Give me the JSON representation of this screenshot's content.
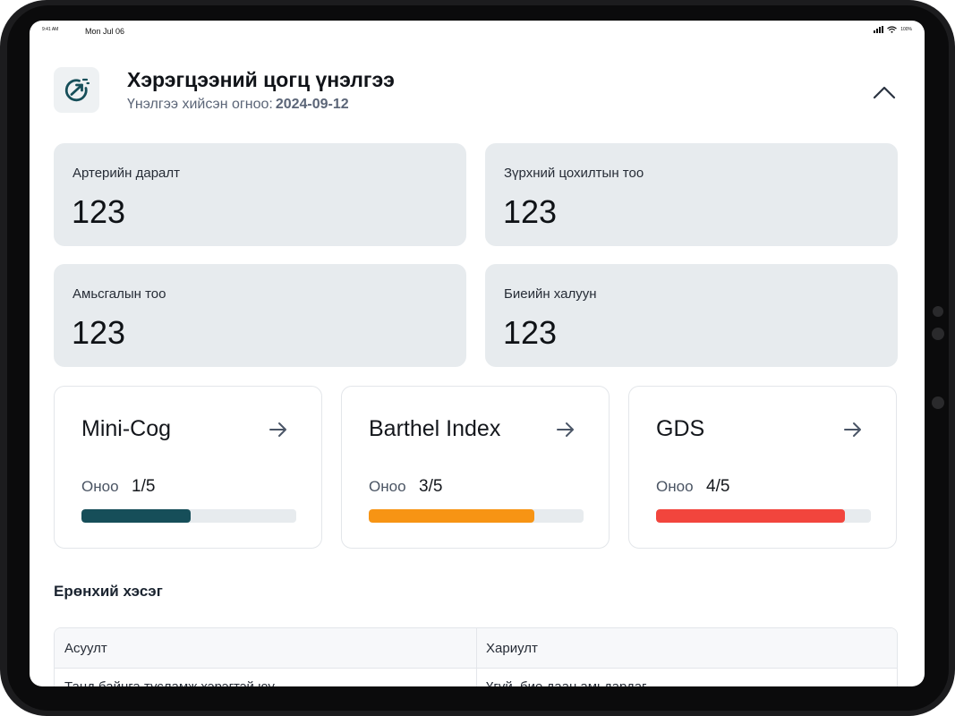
{
  "status_bar": {
    "time": "9:41 AM",
    "date": "Mon Jul 06",
    "battery": "100%"
  },
  "header": {
    "title": "Хэрэгцээний цогц үнэлгээ",
    "subtitle_label": "Үнэлгээ хийсэн огноо:",
    "subtitle_date": "2024-09-12",
    "icon": "gauge-icon",
    "collapse_icon": "chevron-up-icon"
  },
  "vitals": [
    {
      "label": "Артерийн даралт",
      "value": "123"
    },
    {
      "label": "Зүрхний цохилтын тоо",
      "value": "123"
    },
    {
      "label": "Амьсгалын тоо",
      "value": "123"
    },
    {
      "label": "Биеийн халуун",
      "value": "123"
    }
  ],
  "scores": [
    {
      "title": "Mini-Cog",
      "label": "Оноо",
      "value": "1/5",
      "progress": 0.51,
      "color": "#164e59"
    },
    {
      "title": "Barthel Index",
      "label": "Оноо",
      "value": "3/5",
      "progress": 0.77,
      "color": "#f79414"
    },
    {
      "title": "GDS",
      "label": "Оноо",
      "value": "4/5",
      "progress": 0.88,
      "color": "#f2453d"
    }
  ],
  "section": {
    "title": "Ерөнхий хэсэг"
  },
  "table": {
    "headers": [
      "Асуулт",
      "Хариулт"
    ],
    "rows": [
      [
        "Танд байнга тусламж хэрэгтэй юу",
        "Үгүй, бие даан амьдардаг"
      ]
    ]
  },
  "colors": {
    "card_bg": "#e7ebee",
    "brand": "#164e59"
  }
}
